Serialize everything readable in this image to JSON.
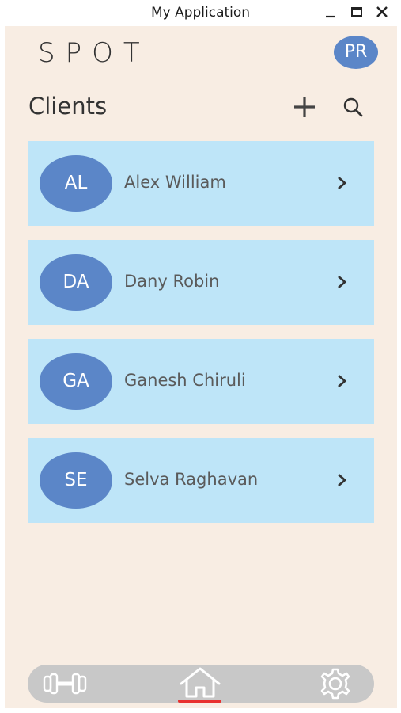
{
  "window": {
    "title": "My Application"
  },
  "header": {
    "logo": "SPOT",
    "profile_initials": "PR"
  },
  "page": {
    "title": "Clients"
  },
  "clients": [
    {
      "initials": "AL",
      "name": "Alex William"
    },
    {
      "initials": "DA",
      "name": "Dany Robin"
    },
    {
      "initials": "GA",
      "name": "Ganesh Chiruli"
    },
    {
      "initials": "SE",
      "name": "Selva Raghavan"
    }
  ],
  "bottom_nav": {
    "items": [
      {
        "icon": "dumbbell-icon"
      },
      {
        "icon": "home-icon",
        "active": true
      },
      {
        "icon": "gear-icon"
      }
    ]
  },
  "colors": {
    "app_background": "#f8ede3",
    "card_background": "#bee5f8",
    "avatar": "#5b86c8",
    "nav_background": "#c8c8c8",
    "active_indicator": "#e8312f"
  }
}
